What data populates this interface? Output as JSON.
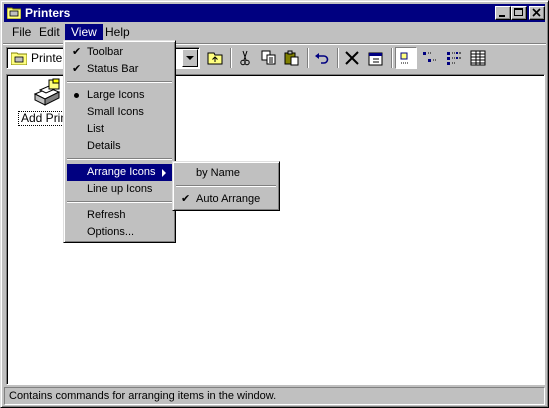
{
  "window": {
    "title": "Printers"
  },
  "menubar": {
    "items": [
      "File",
      "Edit",
      "View",
      "Help"
    ]
  },
  "address": {
    "value": "Printers"
  },
  "content": {
    "items": [
      {
        "label": "Add Printer",
        "icon": "add-printer-icon"
      }
    ]
  },
  "view_menu": {
    "toolbar": "Toolbar",
    "status_bar": "Status Bar",
    "large_icons": "Large Icons",
    "small_icons": "Small Icons",
    "list": "List",
    "details": "Details",
    "arrange_icons": "Arrange Icons",
    "line_up_icons": "Line up Icons",
    "refresh": "Refresh",
    "options": "Options...",
    "checked": [
      "Toolbar",
      "Status Bar",
      "Auto Arrange"
    ],
    "selected_view": "Large Icons"
  },
  "arrange_submenu": {
    "by_name": "by Name",
    "auto_arrange": "Auto Arrange"
  },
  "status": {
    "text": "Contains commands for arranging items in the window."
  },
  "check_glyph": "✔",
  "colors": {
    "title_bar": "#000080",
    "face": "#c0c0c0",
    "highlight": "#000080"
  }
}
